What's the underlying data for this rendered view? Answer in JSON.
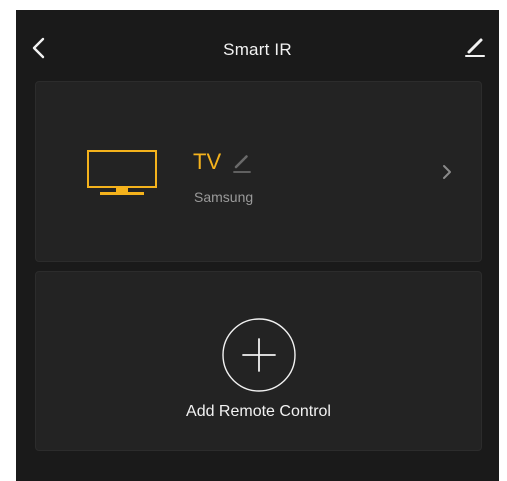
{
  "header": {
    "title": "Smart IR",
    "back_icon": "chevron-left-icon",
    "edit_icon": "pencil-icon"
  },
  "devices": [
    {
      "name": "TV",
      "brand": "Samsung",
      "icon": "tv-icon",
      "accent_color": "#f4b21c"
    }
  ],
  "add_card": {
    "label": "Add Remote Control",
    "icon": "plus-circle-icon"
  },
  "colors": {
    "background": "#1a1a1a",
    "card": "#232323",
    "accent": "#f4b21c",
    "text": "#f2f2f2",
    "muted": "#9a9a9a"
  }
}
